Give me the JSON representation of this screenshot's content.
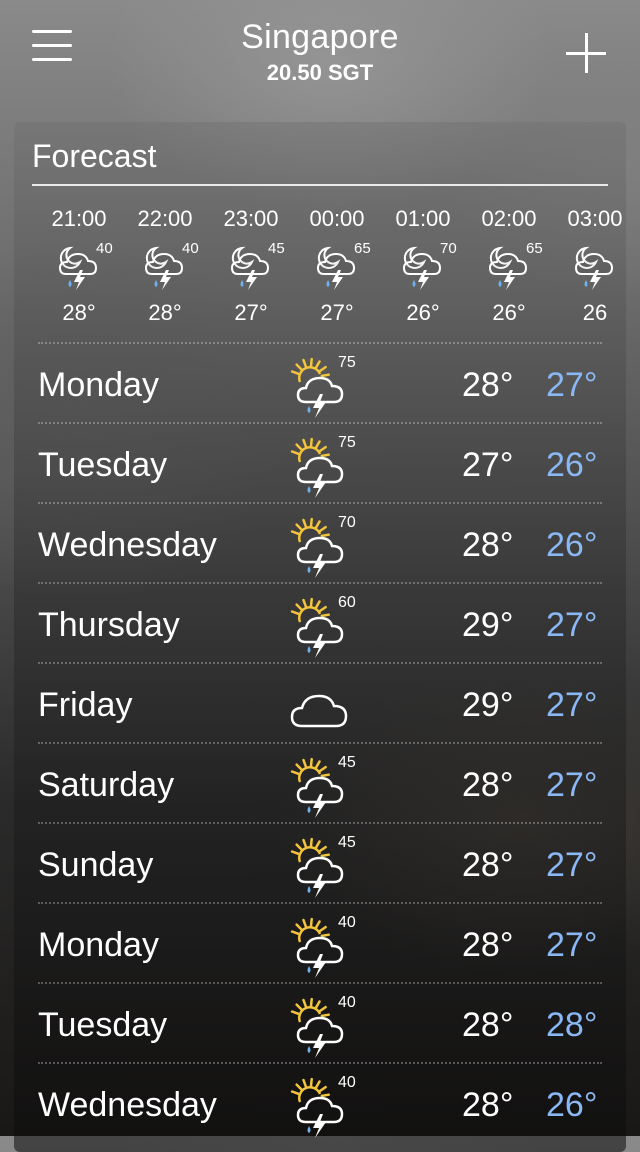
{
  "header": {
    "city": "Singapore",
    "time": "20.50 SGT",
    "menu_icon": "menu-icon",
    "add_icon": "plus-icon"
  },
  "forecast": {
    "title": "Forecast",
    "hourly": [
      {
        "time": "21:00",
        "chance": "40",
        "temp": "28°",
        "icon": "night-thunderstorm-icon"
      },
      {
        "time": "22:00",
        "chance": "40",
        "temp": "28°",
        "icon": "night-thunderstorm-icon"
      },
      {
        "time": "23:00",
        "chance": "45",
        "temp": "27°",
        "icon": "night-thunderstorm-icon"
      },
      {
        "time": "00:00",
        "chance": "65",
        "temp": "27°",
        "icon": "night-thunderstorm-icon"
      },
      {
        "time": "01:00",
        "chance": "70",
        "temp": "26°",
        "icon": "night-thunderstorm-icon"
      },
      {
        "time": "02:00",
        "chance": "65",
        "temp": "26°",
        "icon": "night-thunderstorm-icon"
      },
      {
        "time": "03:00",
        "chance": "",
        "temp": "26",
        "icon": "night-thunderstorm-icon"
      }
    ],
    "daily": [
      {
        "day": "Monday",
        "chance": "75",
        "high": "28°",
        "low": "27°",
        "icon": "sun-thunderstorm-icon"
      },
      {
        "day": "Tuesday",
        "chance": "75",
        "high": "27°",
        "low": "26°",
        "icon": "sun-thunderstorm-icon"
      },
      {
        "day": "Wednesday",
        "chance": "70",
        "high": "28°",
        "low": "26°",
        "icon": "sun-thunderstorm-icon"
      },
      {
        "day": "Thursday",
        "chance": "60",
        "high": "29°",
        "low": "27°",
        "icon": "sun-thunderstorm-icon"
      },
      {
        "day": "Friday",
        "chance": "",
        "high": "29°",
        "low": "27°",
        "icon": "cloud-icon"
      },
      {
        "day": "Saturday",
        "chance": "45",
        "high": "28°",
        "low": "27°",
        "icon": "sun-thunderstorm-icon"
      },
      {
        "day": "Sunday",
        "chance": "45",
        "high": "28°",
        "low": "27°",
        "icon": "sun-thunderstorm-icon"
      },
      {
        "day": "Monday",
        "chance": "40",
        "high": "28°",
        "low": "27°",
        "icon": "sun-thunderstorm-icon"
      },
      {
        "day": "Tuesday",
        "chance": "40",
        "high": "28°",
        "low": "28°",
        "icon": "sun-thunderstorm-icon"
      },
      {
        "day": "Wednesday",
        "chance": "40",
        "high": "28°",
        "low": "26°",
        "icon": "sun-thunderstorm-icon"
      }
    ]
  },
  "colors": {
    "low_temp": "#8ab8f4",
    "sun": "#f2c53d",
    "rain": "#6fb0ee"
  }
}
